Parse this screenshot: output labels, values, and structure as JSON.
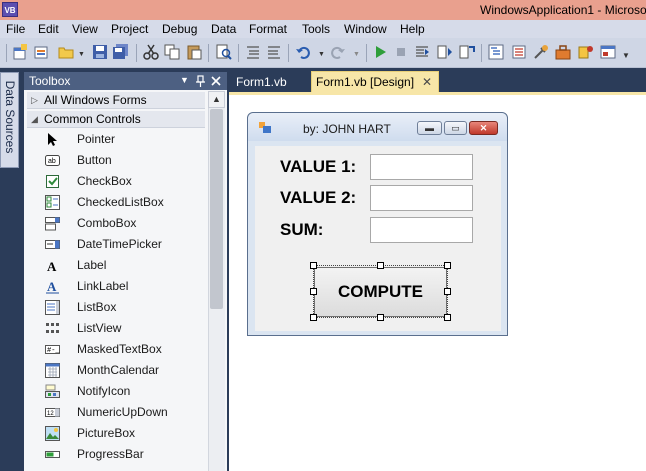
{
  "window": {
    "title": "WindowsApplication1 - Microso",
    "icon": "VB"
  },
  "menu": [
    "File",
    "Edit",
    "View",
    "Project",
    "Debug",
    "Data",
    "Format",
    "Tools",
    "Window",
    "Help"
  ],
  "left_tab": {
    "label": "Data Sources"
  },
  "toolbox": {
    "title": "Toolbox",
    "groups": [
      "All Windows Forms",
      "Common Controls"
    ],
    "items": [
      {
        "label": "Pointer",
        "icon": "pointer-icon"
      },
      {
        "label": "Button",
        "icon": "button-icon"
      },
      {
        "label": "CheckBox",
        "icon": "checkbox-icon"
      },
      {
        "label": "CheckedListBox",
        "icon": "checkedlistbox-icon"
      },
      {
        "label": "ComboBox",
        "icon": "combobox-icon"
      },
      {
        "label": "DateTimePicker",
        "icon": "datetimepicker-icon"
      },
      {
        "label": "Label",
        "icon": "label-icon"
      },
      {
        "label": "LinkLabel",
        "icon": "linklabel-icon"
      },
      {
        "label": "ListBox",
        "icon": "listbox-icon"
      },
      {
        "label": "ListView",
        "icon": "listview-icon"
      },
      {
        "label": "MaskedTextBox",
        "icon": "maskedtextbox-icon"
      },
      {
        "label": "MonthCalendar",
        "icon": "monthcalendar-icon"
      },
      {
        "label": "NotifyIcon",
        "icon": "notifyicon-icon"
      },
      {
        "label": "NumericUpDown",
        "icon": "numericupdown-icon"
      },
      {
        "label": "PictureBox",
        "icon": "picturebox-icon"
      },
      {
        "label": "ProgressBar",
        "icon": "progressbar-icon"
      }
    ]
  },
  "tabs": [
    {
      "label": "Form1.vb",
      "active": false
    },
    {
      "label": "Form1.vb [Design]",
      "active": true
    }
  ],
  "form": {
    "title": "by: JOHN HART",
    "labels": [
      "VALUE 1:",
      "VALUE 2:",
      "SUM:"
    ],
    "textbox_values": [
      "",
      "",
      ""
    ],
    "button_label": "COMPUTE"
  },
  "colors": {
    "titlebar": "#e9a08e",
    "ide_background": "#2b3c59",
    "active_tab": "#f7e6a8",
    "menubar": "#d6dbe9"
  }
}
